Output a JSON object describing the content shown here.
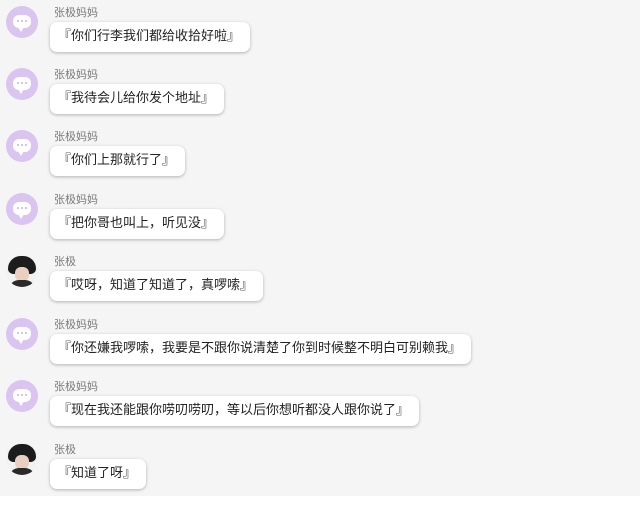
{
  "messages": [
    {
      "sender": "张极妈妈",
      "avatar": "mom",
      "text": "『你们行李我们都给收拾好啦』"
    },
    {
      "sender": "张极妈妈",
      "avatar": "mom",
      "text": "『我待会儿给你发个地址』"
    },
    {
      "sender": "张极妈妈",
      "avatar": "mom",
      "text": "『你们上那就行了』"
    },
    {
      "sender": "张极妈妈",
      "avatar": "mom",
      "text": "『把你哥也叫上，听见没』"
    },
    {
      "sender": "张极",
      "avatar": "son",
      "text": "『哎呀，知道了知道了，真啰嗦』"
    },
    {
      "sender": "张极妈妈",
      "avatar": "mom",
      "text": "『你还嫌我啰嗦，我要是不跟你说清楚了你到时候整不明白可别赖我』"
    },
    {
      "sender": "张极妈妈",
      "avatar": "mom",
      "text": "『现在我还能跟你唠叨唠叨，等以后你想听都没人跟你说了』"
    },
    {
      "sender": "张极",
      "avatar": "son",
      "text": "『知道了呀』"
    }
  ],
  "colors": {
    "background": "#f5f5f5",
    "mom_avatar": "#d9c5ef",
    "bubble": "#ffffff",
    "sender_name": "#7a7a7a",
    "text": "#222222"
  },
  "icons": {
    "mom_avatar": "chat-bubble-avatar-icon",
    "son_avatar": "user-photo-avatar"
  }
}
